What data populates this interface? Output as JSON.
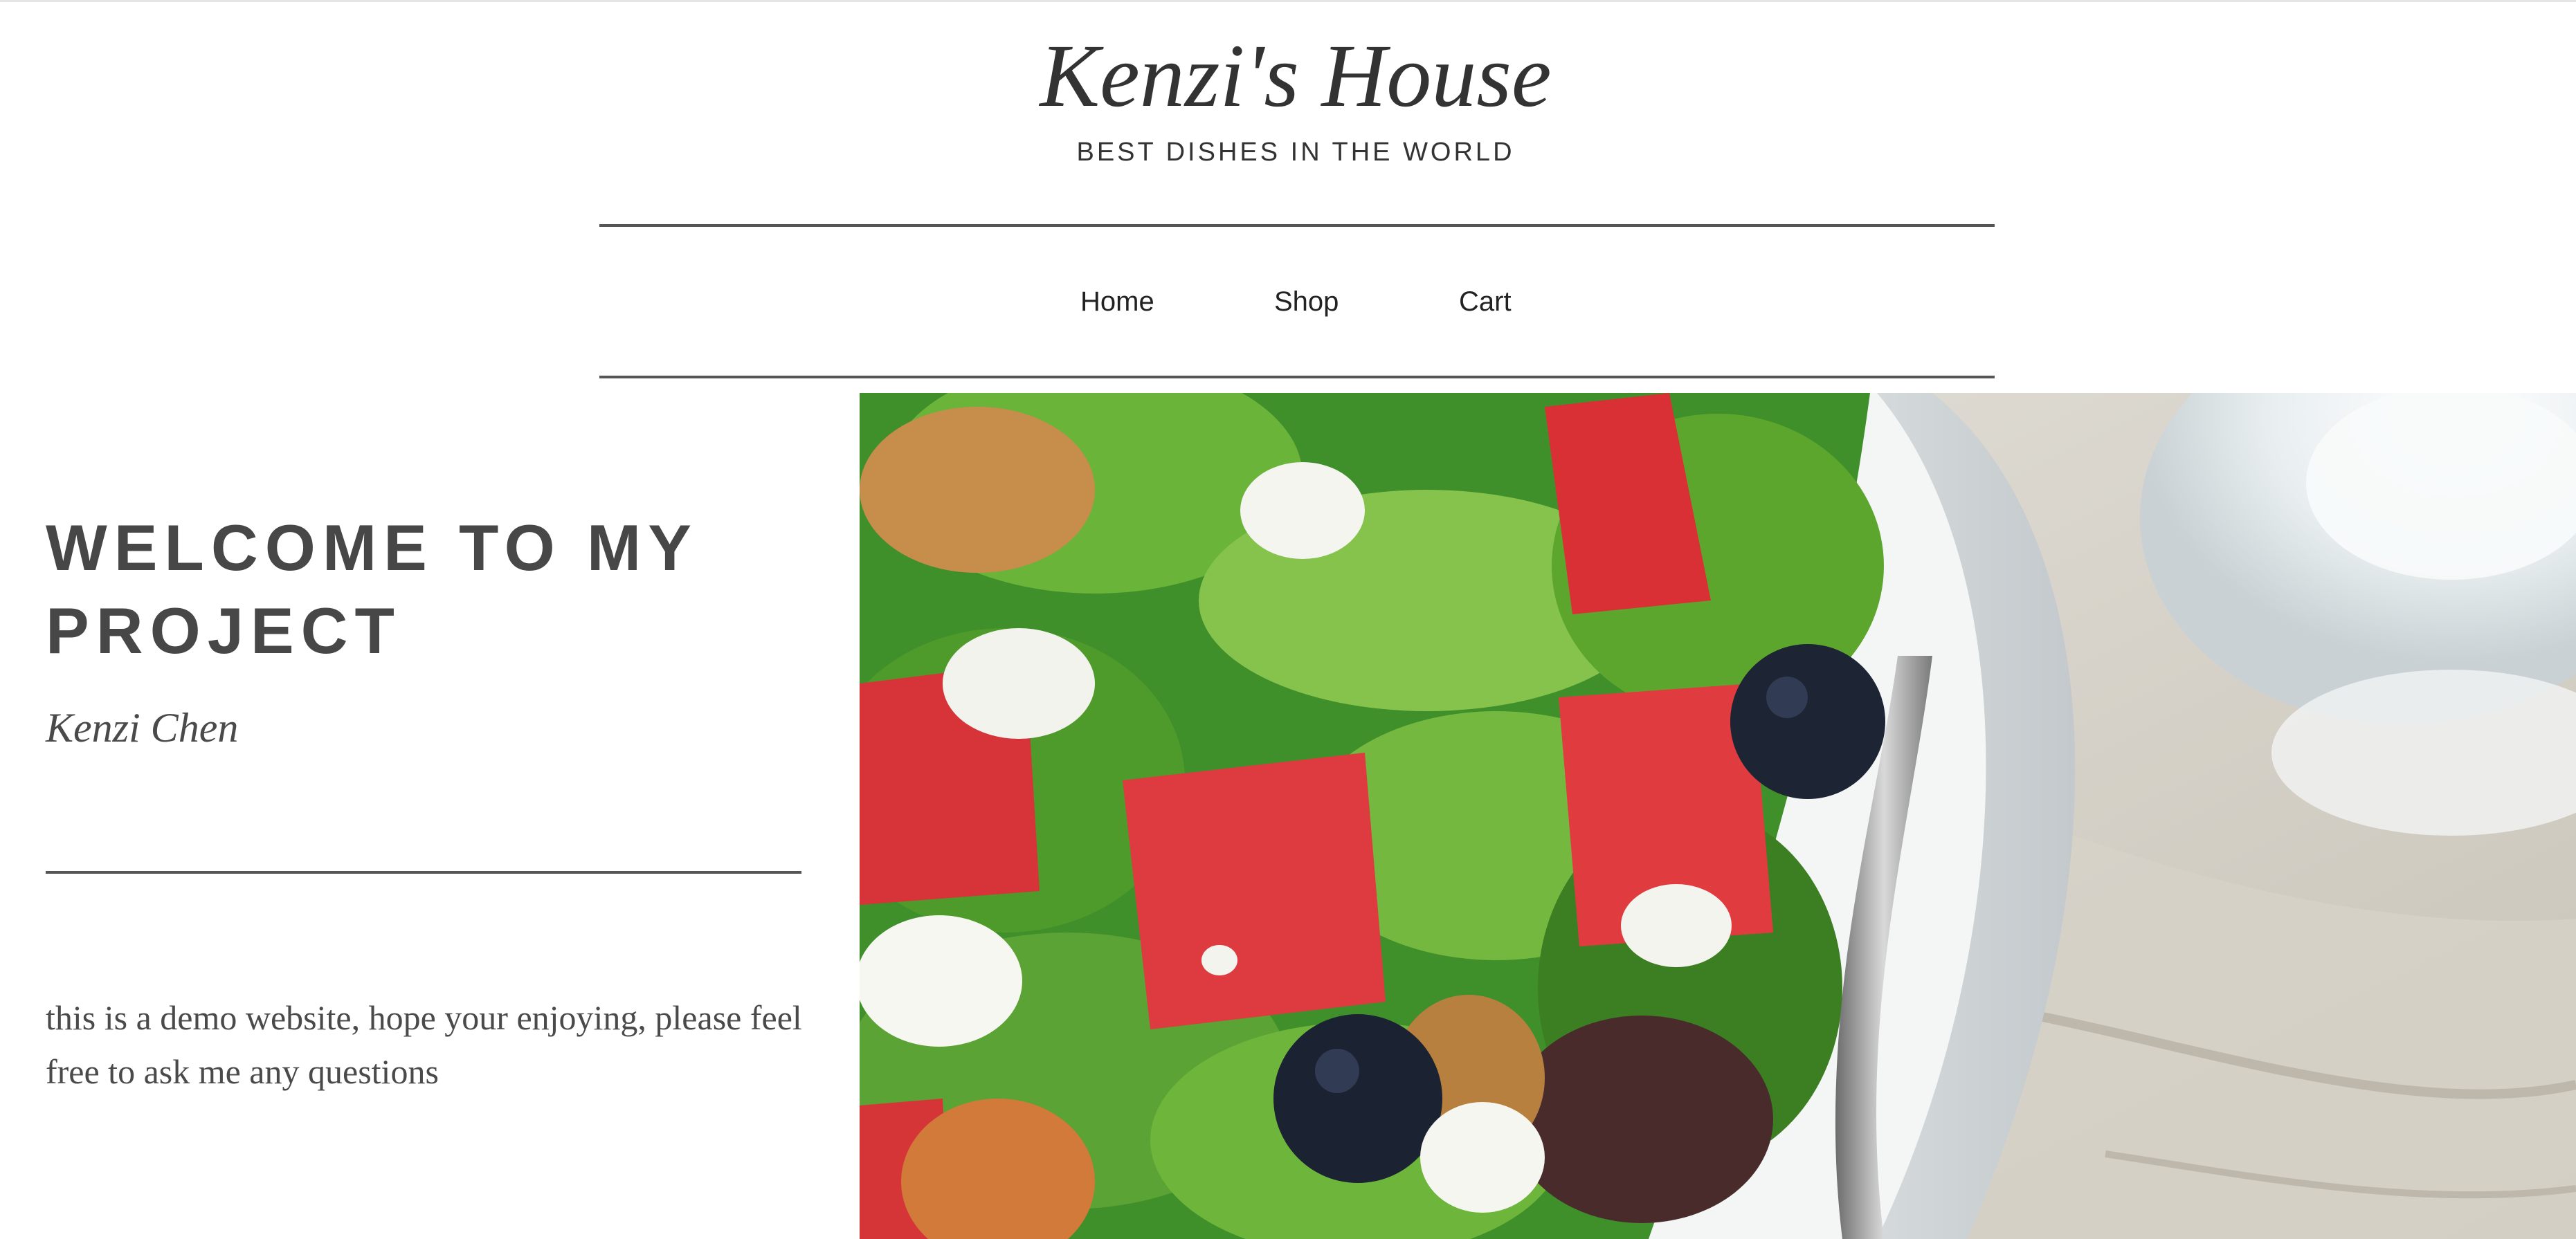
{
  "header": {
    "title": "Kenzi's House",
    "tagline": "BEST DISHES IN THE WORLD"
  },
  "nav": {
    "items": [
      "Home",
      "Shop",
      "Cart"
    ]
  },
  "intro": {
    "heading": "WELCOME TO MY PROJECT",
    "author": "Kenzi Chen",
    "description": "this is a demo website, hope your enjoying, please feel free to ask me any questions"
  },
  "hero": {
    "image": "salad-bowl-photo"
  }
}
